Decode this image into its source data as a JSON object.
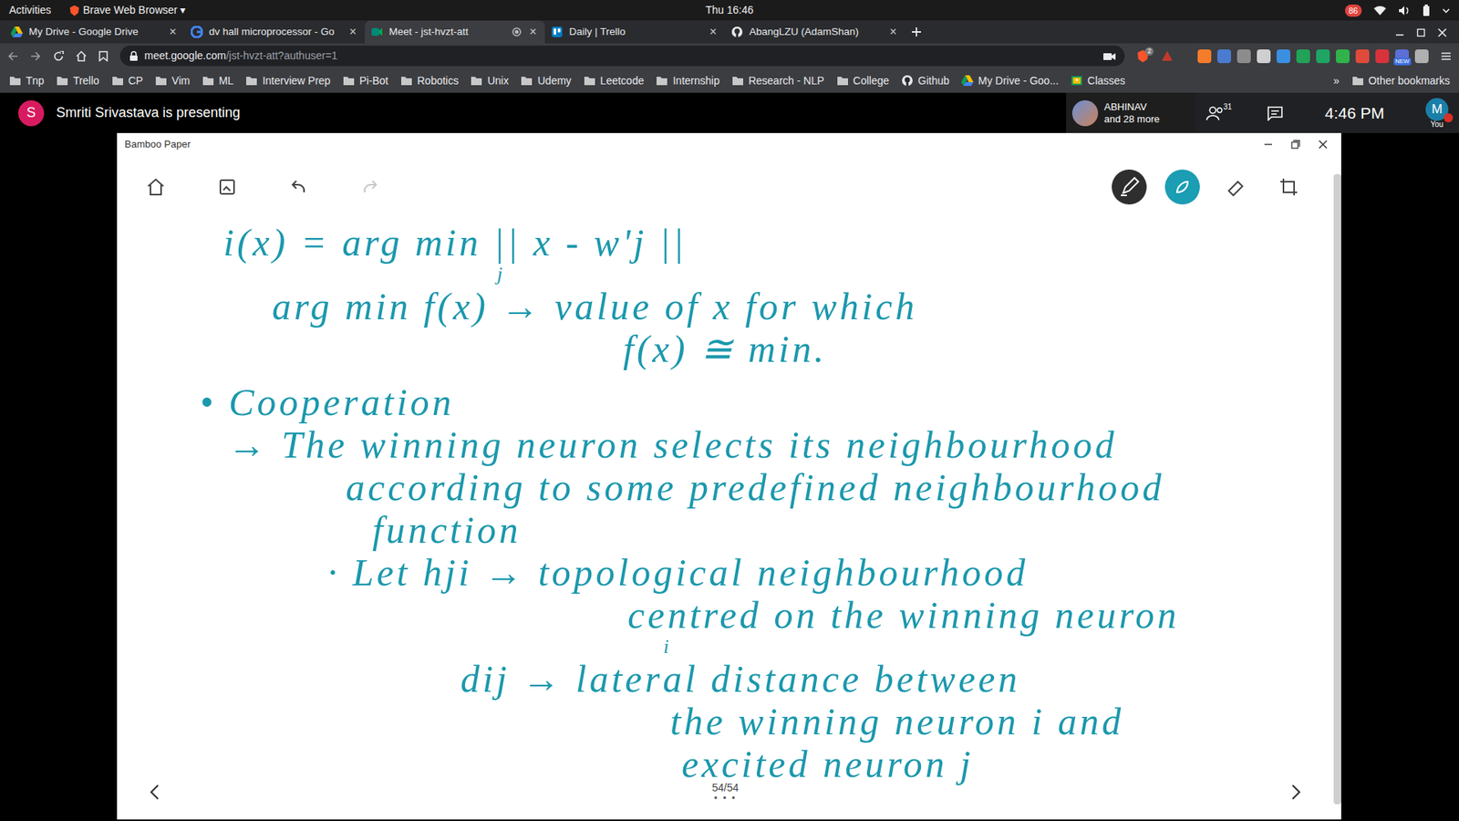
{
  "system_bar": {
    "activities": "Activities",
    "app_menu": "Brave Web Browser ▾",
    "clock": "Thu 16:46",
    "notification_count": "86"
  },
  "tabs": [
    {
      "label": "My Drive - Google Drive",
      "selected": false,
      "kind": "drive"
    },
    {
      "label": "dv hall microprocessor - Go",
      "selected": false,
      "kind": "google"
    },
    {
      "label": "Meet - jst-hvzt-att",
      "selected": true,
      "kind": "meet"
    },
    {
      "label": "Daily | Trello",
      "selected": false,
      "kind": "trello"
    },
    {
      "label": "AbangLZU (AdamShan)",
      "selected": false,
      "kind": "github"
    }
  ],
  "tab_close": "×",
  "address": {
    "url_host": "meet.google.com",
    "url_path": "/jst-hvzt-att?authuser=1",
    "shield_count": "2",
    "extension_badge": "NEW"
  },
  "bookmarks": [
    {
      "label": "Tnp",
      "kind": "folder"
    },
    {
      "label": "Trello",
      "kind": "folder"
    },
    {
      "label": "CP",
      "kind": "folder"
    },
    {
      "label": "Vim",
      "kind": "folder"
    },
    {
      "label": "ML",
      "kind": "folder"
    },
    {
      "label": "Interview Prep",
      "kind": "folder"
    },
    {
      "label": "Pi-Bot",
      "kind": "folder"
    },
    {
      "label": "Robotics",
      "kind": "folder"
    },
    {
      "label": "Unix",
      "kind": "folder"
    },
    {
      "label": "Udemy",
      "kind": "folder"
    },
    {
      "label": "Leetcode",
      "kind": "folder"
    },
    {
      "label": "Internship",
      "kind": "folder"
    },
    {
      "label": "Research - NLP",
      "kind": "folder"
    },
    {
      "label": "College",
      "kind": "folder"
    },
    {
      "label": "Github",
      "kind": "github"
    },
    {
      "label": "My Drive - Goo...",
      "kind": "drive"
    },
    {
      "label": "Classes",
      "kind": "classroom"
    }
  ],
  "bookmarks_overflow": "»",
  "other_bookmarks": "Other bookmarks",
  "meet": {
    "presenter_avatar": "S",
    "presenting": "Smriti Srivastava is presenting",
    "participant_name": "ABHINAV",
    "participant_more": "and 28 more",
    "people_count": "31",
    "time": "4:46 PM",
    "self_avatar": "M",
    "self_label": "You"
  },
  "bamboo": {
    "title": "Bamboo Paper",
    "page": "54/54",
    "more": "• • •",
    "lines": [
      {
        "text": "i(x) = arg min || x - w'j ||",
        "kind": "line"
      },
      {
        "text": "j",
        "kind": "note"
      },
      {
        "text": "arg min f(x) → value of x for which",
        "kind": "line"
      },
      {
        "text": "f(x) ≅ min.",
        "kind": "line"
      },
      {
        "text": "• Cooperation",
        "kind": "line"
      },
      {
        "text": "→ The winning neuron selects its neighbourhood",
        "kind": "line"
      },
      {
        "text": "according to some predefined neighbourhood",
        "kind": "line"
      },
      {
        "text": "function",
        "kind": "line"
      },
      {
        "text": "· Let hji → topological neighbourhood",
        "kind": "line"
      },
      {
        "text": "centred on the winning neuron",
        "kind": "line"
      },
      {
        "text": "i",
        "kind": "note"
      },
      {
        "text": "dij → lateral distance between",
        "kind": "line"
      },
      {
        "text": "the winning neuron i and",
        "kind": "line"
      },
      {
        "text": "excited neuron j",
        "kind": "line"
      }
    ]
  }
}
